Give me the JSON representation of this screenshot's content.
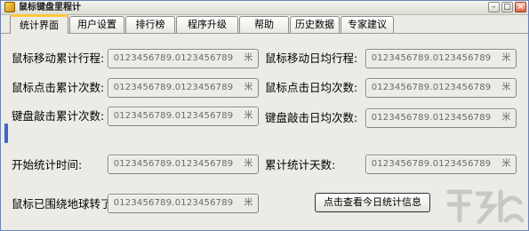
{
  "window": {
    "title": "鼠标键盘里程计",
    "controls": {
      "minimize": "–",
      "maximize": "□",
      "close": "×"
    }
  },
  "tabs": [
    {
      "label": "统计界面",
      "active": true
    },
    {
      "label": "用户设置",
      "active": false
    },
    {
      "label": "排行榜",
      "active": false
    },
    {
      "label": "程序升级",
      "active": false
    },
    {
      "label": "帮助",
      "active": false
    },
    {
      "label": "历史数据",
      "active": false
    },
    {
      "label": "专家建议",
      "active": false
    }
  ],
  "stats": {
    "mouse_move_total": {
      "label": "鼠标移动累计行程:",
      "value": "0123456789.0123456789",
      "unit": "米"
    },
    "mouse_move_daily": {
      "label": "鼠标移动日均行程:",
      "value": "0123456789.0123456789",
      "unit": "米"
    },
    "mouse_click_total": {
      "label": "鼠标点击累计次数:",
      "value": "0123456789.0123456789",
      "unit": "米"
    },
    "mouse_click_daily": {
      "label": "鼠标点击日均次数:",
      "value": "0123456789.0123456789",
      "unit": "米"
    },
    "key_total": {
      "label": "键盘敲击累计次数:",
      "value": "0123456789.0123456789",
      "unit": "米"
    },
    "key_daily": {
      "label": "键盘敲击日均次数:",
      "value": "0123456789.0123456789",
      "unit": "米"
    },
    "start_time": {
      "label": "开始统计时间:",
      "value": "0123456789.0123456789",
      "unit": "米"
    },
    "total_days": {
      "label": "累计统计天数:",
      "value": "0123456789.0123456789",
      "unit": "米"
    },
    "earth_laps": {
      "label": "鼠标已围绕地球转了:",
      "value": "0123456789.0123456789",
      "unit": "米"
    }
  },
  "today_button": {
    "label": "点击查看今日统计信息"
  },
  "colors": {
    "accent_tab": "#ffc83d",
    "side_handle": "#3b67c9",
    "window_bg": "#ecebe5"
  },
  "icons": {
    "app": "app-icon",
    "watermark": "watermark-logo"
  }
}
